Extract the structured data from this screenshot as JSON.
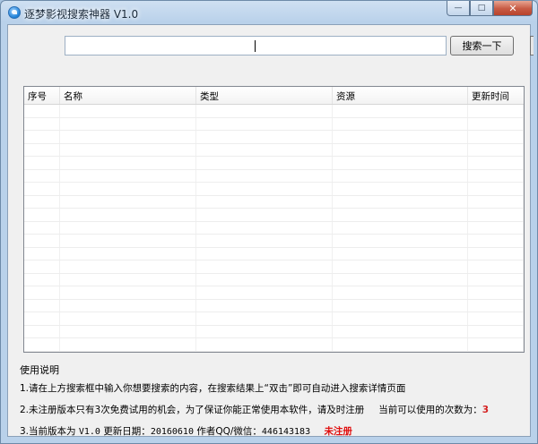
{
  "window": {
    "title": "逐梦影视搜索神器 V1.0",
    "controls": {
      "minimize": "—",
      "maximize": "□",
      "close": "✕"
    }
  },
  "search": {
    "value": "",
    "placeholder": "",
    "button_label": "搜索一下"
  },
  "results_table": {
    "columns": [
      "序号",
      "名称",
      "类型",
      "资源",
      "更新时间"
    ],
    "rows": []
  },
  "instructions": {
    "title": "使用说明",
    "line1": "1.请在上方搜索框中输入你想要搜索的内容，在搜索结果上“双击”即可自动进入搜索详情页面",
    "line2_text": "2.未注册版本只有3次免费试用的机会，为了保证你能正常使用本软件，请及时注册",
    "remaining_label": "当前可以使用的次数为：",
    "remaining_value": "3",
    "line3_prefix": "3.当前版本为",
    "version": "V1.0",
    "update_label": "更新日期：",
    "update_date": "20160610",
    "author_label": "作者QQ/微信：",
    "author_contact": "446143183",
    "registration_status": "未注册"
  },
  "colors": {
    "status_red": "#e01010",
    "window_frame": "#b9d1ea",
    "close_button": "#c75a43"
  },
  "icons": {
    "app": "app-bird-icon"
  }
}
